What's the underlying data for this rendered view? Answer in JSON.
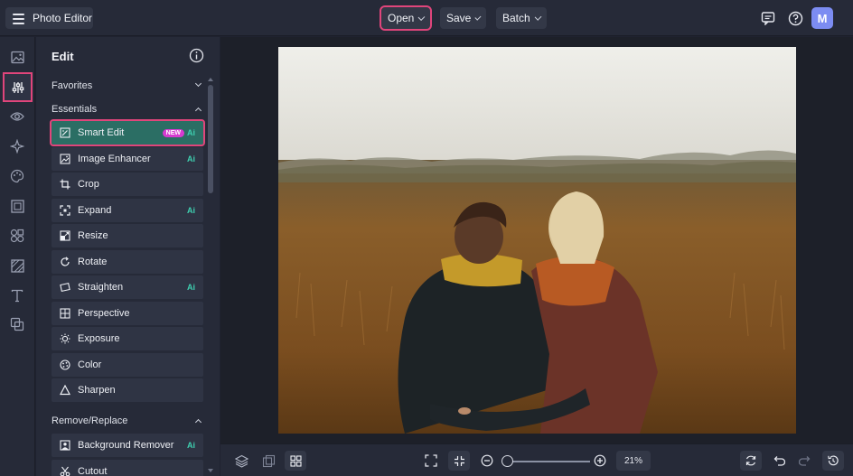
{
  "app": {
    "title": "Photo Editor"
  },
  "topbar": {
    "open_label": "Open",
    "save_label": "Save",
    "batch_label": "Batch",
    "avatar_initial": "M"
  },
  "rail": {
    "icons": [
      "image-icon",
      "sliders-icon",
      "eye-icon",
      "sparkle-icon",
      "palette-icon",
      "frame-icon",
      "shapes-icon",
      "texture-icon",
      "text-icon",
      "overlay-icon"
    ]
  },
  "panel": {
    "title": "Edit",
    "sections": {
      "favorites": "Favorites",
      "essentials": "Essentials",
      "remove_replace": "Remove/Replace"
    },
    "tools": [
      {
        "label": "Smart Edit",
        "badge": "NEW",
        "ai": "Ai",
        "icon": "smart-edit-icon"
      },
      {
        "label": "Image Enhancer",
        "ai": "Ai",
        "icon": "enhancer-icon"
      },
      {
        "label": "Crop",
        "icon": "crop-icon"
      },
      {
        "label": "Expand",
        "ai": "Ai",
        "icon": "expand-icon"
      },
      {
        "label": "Resize",
        "icon": "resize-icon"
      },
      {
        "label": "Rotate",
        "icon": "rotate-icon"
      },
      {
        "label": "Straighten",
        "ai": "Ai",
        "icon": "straighten-icon"
      },
      {
        "label": "Perspective",
        "icon": "perspective-icon"
      },
      {
        "label": "Exposure",
        "icon": "exposure-icon"
      },
      {
        "label": "Color",
        "icon": "color-icon"
      },
      {
        "label": "Sharpen",
        "icon": "sharpen-icon"
      }
    ],
    "remove_tools": [
      {
        "label": "Background Remover",
        "ai": "Ai",
        "icon": "background-remover-icon"
      },
      {
        "label": "Cutout",
        "icon": "cutout-icon"
      }
    ]
  },
  "bottombar": {
    "zoom": "21%",
    "zoom_level": 0.21
  },
  "colors": {
    "accent_highlight": "#e0457b",
    "selected_tool": "#2b6e64",
    "ai_badge": "#3fd0b0",
    "new_badge": "#d63bd0",
    "avatar": "#7c8cf2"
  }
}
